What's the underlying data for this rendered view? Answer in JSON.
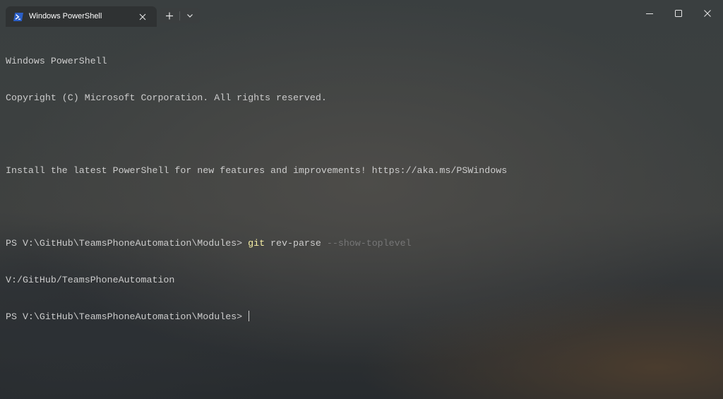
{
  "tab": {
    "title": "Windows PowerShell",
    "icon": "powershell-icon",
    "accent": "#2b5fc7"
  },
  "toolbar": {
    "new_tab_icon": "plus-icon",
    "dropdown_icon": "chevron-down-icon"
  },
  "window_controls": [
    "minimize-icon",
    "maximize-icon",
    "close-icon"
  ],
  "terminal": {
    "banner_line1": "Windows PowerShell",
    "banner_line2": "Copyright (C) Microsoft Corporation. All rights reserved.",
    "banner_line3": "Install the latest PowerShell for new features and improvements! https://aka.ms/PSWindows",
    "prompt1": "PS V:\\GitHub\\TeamsPhoneAutomation\\Modules> ",
    "command_name": "git",
    "command_args": " rev-parse ",
    "command_param": "--show-toplevel",
    "output1": "V:/GitHub/TeamsPhoneAutomation",
    "prompt2": "PS V:\\GitHub\\TeamsPhoneAutomation\\Modules> ",
    "colors": {
      "foreground": "#cccccc",
      "command": "#f9f1a5",
      "parameter": "#767676"
    }
  }
}
